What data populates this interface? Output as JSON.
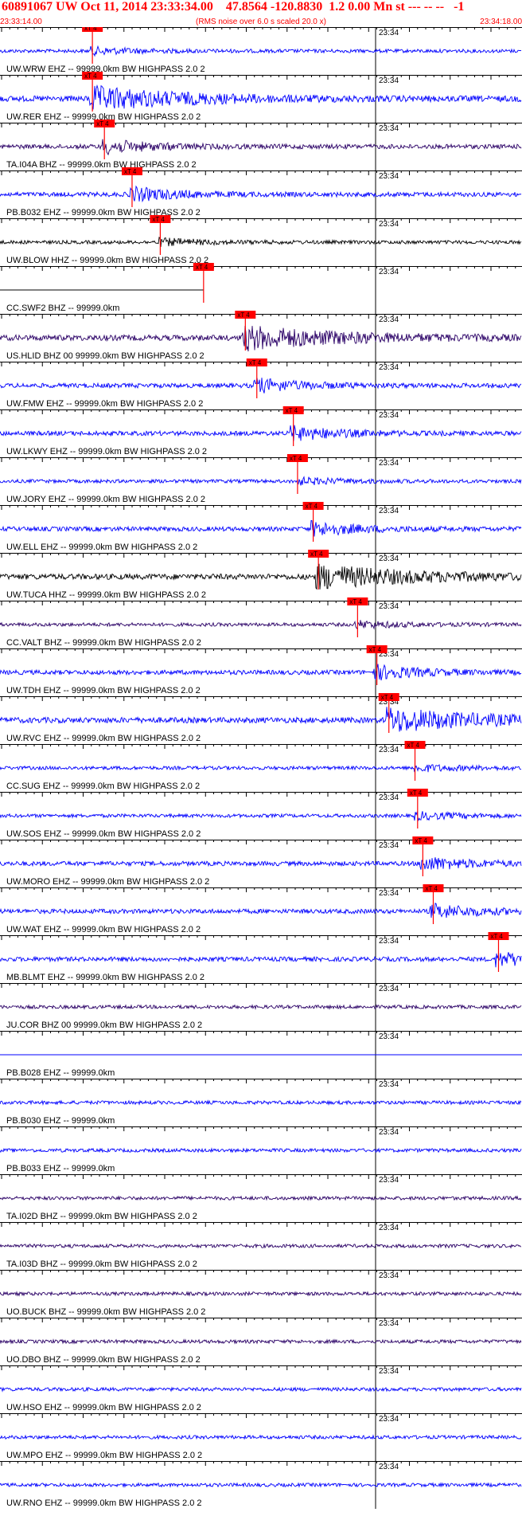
{
  "header": {
    "title": "60891067 UW Oct 11, 2014 23:33:34.00    47.8564 -120.8830  1.2 0.00 Mn st --- -- --   -1",
    "note": "(RMS noise over 6.0 s scaled 20.0 x)",
    "start_time": "23:33:14.00",
    "end_time": "23:34:18.00"
  },
  "minute_mark_label": "23:34",
  "pick_label": "xT 4",
  "traces": [
    {
      "label": "UW.WRW EHZ -- 99999.0km BW  HIGHPASS  2.0  2",
      "color": "#0000ff",
      "amp": "low",
      "pick": 0.177
    },
    {
      "label": "UW.RER EHZ -- 99999.0km BW  HIGHPASS  2.0  2",
      "color": "#0000ff",
      "amp": "high",
      "pick": 0.177
    },
    {
      "label": "TA.I04A BHZ -- 99999.0km BW  HIGHPASS  2.0  2",
      "color": "#2a0066",
      "amp": "mid",
      "pick": 0.2
    },
    {
      "label": "PB.B032 EHZ -- 99999.0km BW  HIGHPASS  2.0  2",
      "color": "#0000ff",
      "amp": "mid",
      "pick": 0.253
    },
    {
      "label": "UW.BLOW HHZ -- 99999.0km BW  HIGHPASS  2.0  2",
      "color": "#000000",
      "amp": "low",
      "pick": 0.307
    },
    {
      "label": "CC.SWF2 BHZ -- 99999.0km",
      "color": "#000000",
      "amp": "none",
      "pick": 0.39
    },
    {
      "label": "US.HLID BHZ 00 99999.0km BW  HIGHPASS  2.0  2",
      "color": "#2a0066",
      "amp": "high",
      "pick": 0.47
    },
    {
      "label": "UW.FMW EHZ -- 99999.0km BW  HIGHPASS  2.0  2",
      "color": "#0000ff",
      "amp": "mid",
      "pick": 0.492
    },
    {
      "label": "UW.LKWY EHZ -- 99999.0km BW  HIGHPASS  2.0  2",
      "color": "#0000ff",
      "amp": "mid",
      "pick": 0.562
    },
    {
      "label": "UW.JORY EHZ -- 99999.0km BW  HIGHPASS  2.0  2",
      "color": "#0000ff",
      "amp": "low",
      "pick": 0.57
    },
    {
      "label": "UW.ELL EHZ -- 99999.0km BW  HIGHPASS  2.0  2",
      "color": "#0000ff",
      "amp": "mid",
      "pick": 0.6
    },
    {
      "label": "UW.TUCA HHZ -- 99999.0km BW  HIGHPASS  2.0  2",
      "color": "#000000",
      "amp": "high",
      "pick": 0.61
    },
    {
      "label": "CC.VALT BHZ -- 99999.0km BW  HIGHPASS  2.0  2",
      "color": "#2a0066",
      "amp": "low",
      "pick": 0.685
    },
    {
      "label": "UW.TDH EHZ -- 99999.0km BW  HIGHPASS  2.0  2",
      "color": "#0000ff",
      "amp": "mid",
      "pick": 0.722
    },
    {
      "label": "UW.RVC EHZ -- 99999.0km BW  HIGHPASS  2.0  2",
      "color": "#0000ff",
      "amp": "high",
      "pick": 0.745
    },
    {
      "label": "CC.SUG EHZ -- 99999.0km BW  HIGHPASS  2.0  2",
      "color": "#0000ff",
      "amp": "low",
      "pick": 0.795
    },
    {
      "label": "UW.SOS EHZ -- 99999.0km BW  HIGHPASS  2.0  2",
      "color": "#0000ff",
      "amp": "low",
      "pick": 0.8
    },
    {
      "label": "UW.MORO EHZ -- 99999.0km BW  HIGHPASS  2.0  2",
      "color": "#0000ff",
      "amp": "mid",
      "pick": 0.81
    },
    {
      "label": "UW.WAT EHZ -- 99999.0km BW  HIGHPASS  2.0  2",
      "color": "#0000ff",
      "amp": "mid",
      "pick": 0.83
    },
    {
      "label": "MB.BLMT EHZ -- 99999.0km BW  HIGHPASS  2.0  2",
      "color": "#0000ff",
      "amp": "mid",
      "pick": 0.955
    },
    {
      "label": "JU.COR BHZ 00 99999.0km BW  HIGHPASS  2.0  2",
      "color": "#2a0066",
      "amp": "low",
      "pick": null
    },
    {
      "label": "PB.B028 EHZ -- 99999.0km",
      "color": "#0000ff",
      "amp": "none",
      "pick": null
    },
    {
      "label": "PB.B030 EHZ -- 99999.0km",
      "color": "#0000ff",
      "amp": "low",
      "pick": null
    },
    {
      "label": "PB.B033 EHZ -- 99999.0km",
      "color": "#0000ff",
      "amp": "low",
      "pick": null
    },
    {
      "label": "TA.I02D BHZ -- 99999.0km BW  HIGHPASS  2.0  2",
      "color": "#2a0066",
      "amp": "low",
      "pick": null
    },
    {
      "label": "TA.I03D BHZ -- 99999.0km BW  HIGHPASS  2.0  2",
      "color": "#2a0066",
      "amp": "low",
      "pick": null
    },
    {
      "label": "UO.BUCK BHZ -- 99999.0km BW  HIGHPASS  2.0  2",
      "color": "#2a0066",
      "amp": "low",
      "pick": null
    },
    {
      "label": "UO.DBO BHZ -- 99999.0km BW  HIGHPASS  2.0  2",
      "color": "#2a0066",
      "amp": "low",
      "pick": null
    },
    {
      "label": "UW.HSO EHZ -- 99999.0km BW  HIGHPASS  2.0  2",
      "color": "#0000ff",
      "amp": "low",
      "pick": null
    },
    {
      "label": "UW.MPO EHZ -- 99999.0km BW  HIGHPASS  2.0  2",
      "color": "#0000ff",
      "amp": "low",
      "pick": null
    },
    {
      "label": "UW.RNO EHZ -- 99999.0km BW  HIGHPASS  2.0  2",
      "color": "#0000ff",
      "amp": "low",
      "pick": null
    }
  ],
  "colors": {
    "pick_line": "#ff0000",
    "pick_box": "#ff0000",
    "header_text": "#ff0000",
    "axis_lines": "#000000"
  }
}
